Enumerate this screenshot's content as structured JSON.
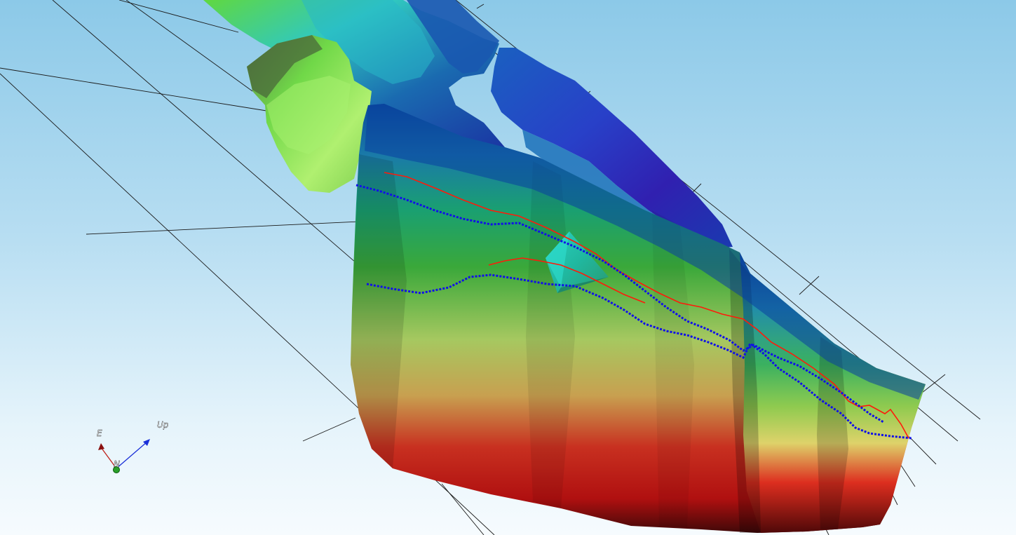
{
  "axes_triad": {
    "east_label": "E",
    "up_label": "Up",
    "north_label": "N",
    "colors": {
      "east": "#c0201a",
      "up": "#1a2fd8",
      "north": "#2aa02a"
    }
  },
  "colors": {
    "background_top": "#8cc9e8",
    "background_bottom": "#f6fbfe",
    "grid_line": "#1a1a1a",
    "well_path_red": "#ff1a0a",
    "well_path_blue": "#1010e8"
  }
}
